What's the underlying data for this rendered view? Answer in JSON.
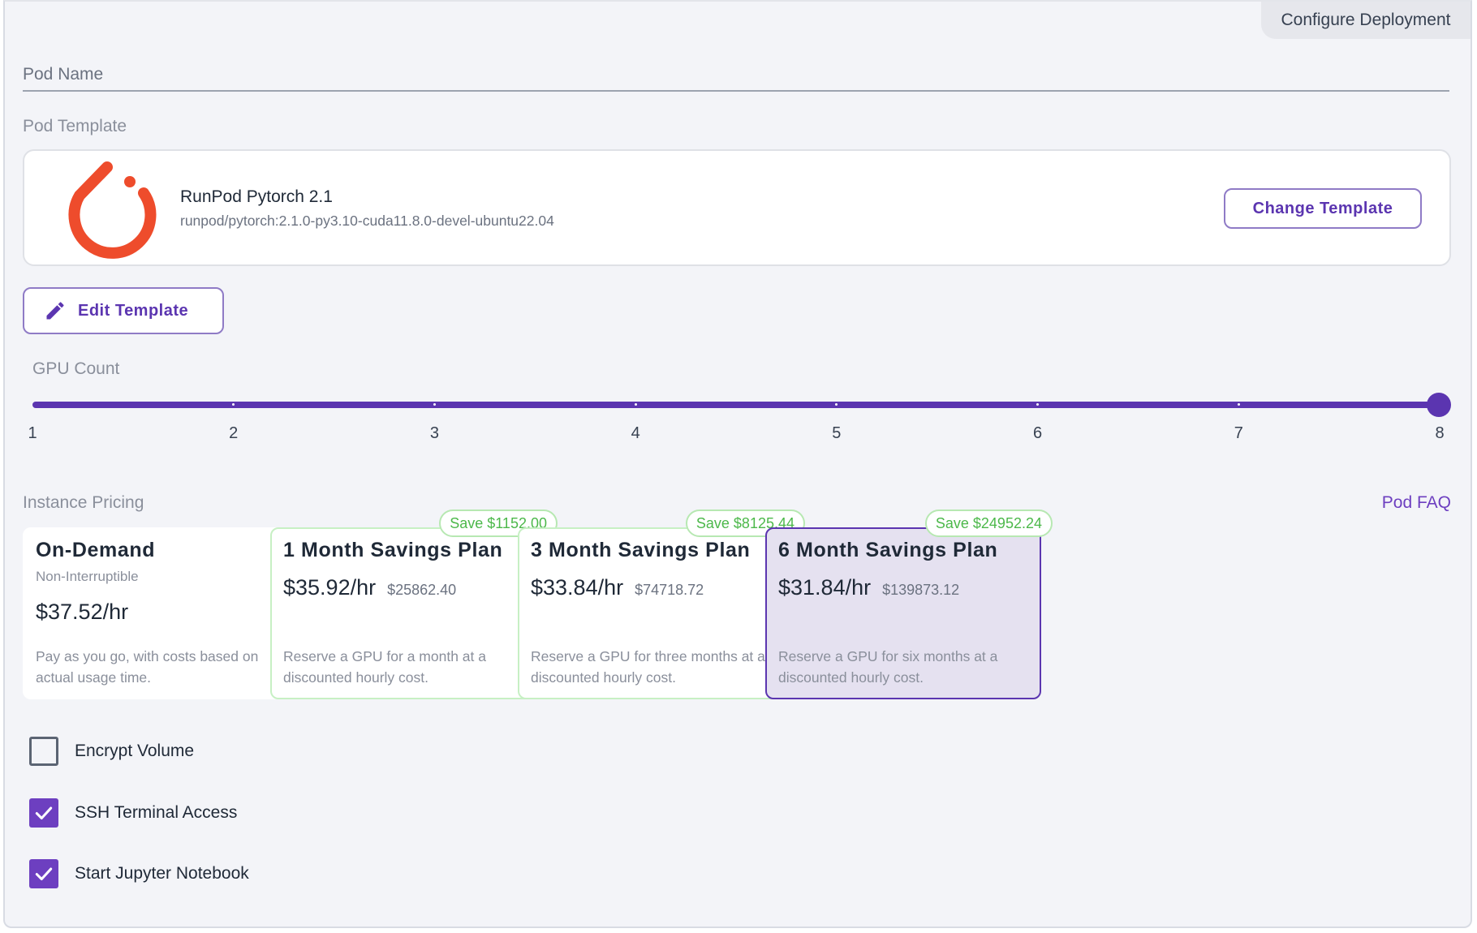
{
  "header": {
    "tab_label": "Configure Deployment"
  },
  "pod_name": {
    "label": "Pod Name",
    "value": ""
  },
  "pod_template": {
    "label": "Pod Template",
    "name": "RunPod Pytorch 2.1",
    "image": "runpod/pytorch:2.1.0-py3.10-cuda11.8.0-devel-ubuntu22.04",
    "logo_icon": "pytorch-logo",
    "change_button": "Change Template",
    "edit_button": "Edit Template"
  },
  "gpu_count": {
    "label": "GPU Count",
    "ticks": [
      "1",
      "2",
      "3",
      "4",
      "5",
      "6",
      "7",
      "8"
    ],
    "value": 8,
    "min": 1,
    "max": 8
  },
  "pricing": {
    "label": "Instance Pricing",
    "faq_link": "Pod FAQ",
    "plans": [
      {
        "title": "On-Demand",
        "subtitle": "Non-Interruptible",
        "rate": "$37.52/hr",
        "total": "",
        "description": "Pay as you go, with costs based on actual usage time.",
        "savings": "",
        "selected": false
      },
      {
        "title": "1 Month Savings Plan",
        "subtitle": "",
        "rate": "$35.92/hr",
        "total": "$25862.40",
        "description": "Reserve a GPU for a month at a discounted hourly cost.",
        "savings": "Save $1152.00",
        "selected": false
      },
      {
        "title": "3 Month Savings Plan",
        "subtitle": "",
        "rate": "$33.84/hr",
        "total": "$74718.72",
        "description": "Reserve a GPU for three months at a discounted hourly cost.",
        "savings": "Save $8125.44",
        "selected": false
      },
      {
        "title": "6 Month Savings Plan",
        "subtitle": "",
        "rate": "$31.84/hr",
        "total": "$139873.12",
        "description": "Reserve a GPU for six months at a discounted hourly cost.",
        "savings": "Save $24952.24",
        "selected": true
      }
    ]
  },
  "options": [
    {
      "label": "Encrypt Volume",
      "checked": false
    },
    {
      "label": "SSH Terminal Access",
      "checked": true
    },
    {
      "label": "Start Jupyter Notebook",
      "checked": true
    }
  ],
  "colors": {
    "accent": "#5b35b0",
    "savings_green": "#4cb84a",
    "pytorch_orange": "#ee4c2c"
  }
}
